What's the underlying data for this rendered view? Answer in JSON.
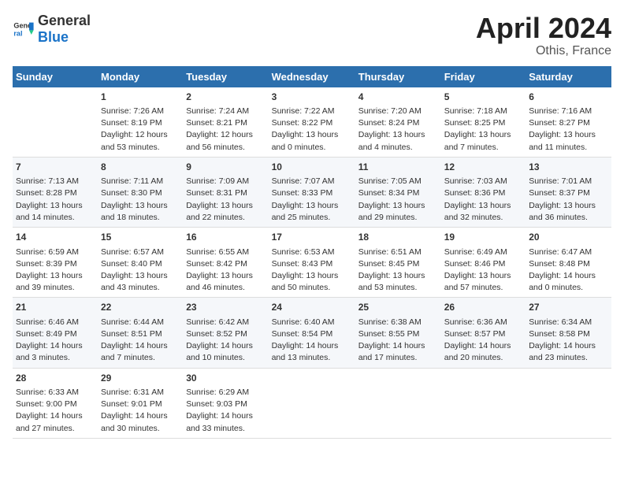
{
  "header": {
    "logo_general": "General",
    "logo_blue": "Blue",
    "title": "April 2024",
    "subtitle": "Othis, France"
  },
  "columns": [
    "Sunday",
    "Monday",
    "Tuesday",
    "Wednesday",
    "Thursday",
    "Friday",
    "Saturday"
  ],
  "weeks": [
    [
      {
        "num": "",
        "info": ""
      },
      {
        "num": "1",
        "info": "Sunrise: 7:26 AM\nSunset: 8:19 PM\nDaylight: 12 hours\nand 53 minutes."
      },
      {
        "num": "2",
        "info": "Sunrise: 7:24 AM\nSunset: 8:21 PM\nDaylight: 12 hours\nand 56 minutes."
      },
      {
        "num": "3",
        "info": "Sunrise: 7:22 AM\nSunset: 8:22 PM\nDaylight: 13 hours\nand 0 minutes."
      },
      {
        "num": "4",
        "info": "Sunrise: 7:20 AM\nSunset: 8:24 PM\nDaylight: 13 hours\nand 4 minutes."
      },
      {
        "num": "5",
        "info": "Sunrise: 7:18 AM\nSunset: 8:25 PM\nDaylight: 13 hours\nand 7 minutes."
      },
      {
        "num": "6",
        "info": "Sunrise: 7:16 AM\nSunset: 8:27 PM\nDaylight: 13 hours\nand 11 minutes."
      }
    ],
    [
      {
        "num": "7",
        "info": "Sunrise: 7:13 AM\nSunset: 8:28 PM\nDaylight: 13 hours\nand 14 minutes."
      },
      {
        "num": "8",
        "info": "Sunrise: 7:11 AM\nSunset: 8:30 PM\nDaylight: 13 hours\nand 18 minutes."
      },
      {
        "num": "9",
        "info": "Sunrise: 7:09 AM\nSunset: 8:31 PM\nDaylight: 13 hours\nand 22 minutes."
      },
      {
        "num": "10",
        "info": "Sunrise: 7:07 AM\nSunset: 8:33 PM\nDaylight: 13 hours\nand 25 minutes."
      },
      {
        "num": "11",
        "info": "Sunrise: 7:05 AM\nSunset: 8:34 PM\nDaylight: 13 hours\nand 29 minutes."
      },
      {
        "num": "12",
        "info": "Sunrise: 7:03 AM\nSunset: 8:36 PM\nDaylight: 13 hours\nand 32 minutes."
      },
      {
        "num": "13",
        "info": "Sunrise: 7:01 AM\nSunset: 8:37 PM\nDaylight: 13 hours\nand 36 minutes."
      }
    ],
    [
      {
        "num": "14",
        "info": "Sunrise: 6:59 AM\nSunset: 8:39 PM\nDaylight: 13 hours\nand 39 minutes."
      },
      {
        "num": "15",
        "info": "Sunrise: 6:57 AM\nSunset: 8:40 PM\nDaylight: 13 hours\nand 43 minutes."
      },
      {
        "num": "16",
        "info": "Sunrise: 6:55 AM\nSunset: 8:42 PM\nDaylight: 13 hours\nand 46 minutes."
      },
      {
        "num": "17",
        "info": "Sunrise: 6:53 AM\nSunset: 8:43 PM\nDaylight: 13 hours\nand 50 minutes."
      },
      {
        "num": "18",
        "info": "Sunrise: 6:51 AM\nSunset: 8:45 PM\nDaylight: 13 hours\nand 53 minutes."
      },
      {
        "num": "19",
        "info": "Sunrise: 6:49 AM\nSunset: 8:46 PM\nDaylight: 13 hours\nand 57 minutes."
      },
      {
        "num": "20",
        "info": "Sunrise: 6:47 AM\nSunset: 8:48 PM\nDaylight: 14 hours\nand 0 minutes."
      }
    ],
    [
      {
        "num": "21",
        "info": "Sunrise: 6:46 AM\nSunset: 8:49 PM\nDaylight: 14 hours\nand 3 minutes."
      },
      {
        "num": "22",
        "info": "Sunrise: 6:44 AM\nSunset: 8:51 PM\nDaylight: 14 hours\nand 7 minutes."
      },
      {
        "num": "23",
        "info": "Sunrise: 6:42 AM\nSunset: 8:52 PM\nDaylight: 14 hours\nand 10 minutes."
      },
      {
        "num": "24",
        "info": "Sunrise: 6:40 AM\nSunset: 8:54 PM\nDaylight: 14 hours\nand 13 minutes."
      },
      {
        "num": "25",
        "info": "Sunrise: 6:38 AM\nSunset: 8:55 PM\nDaylight: 14 hours\nand 17 minutes."
      },
      {
        "num": "26",
        "info": "Sunrise: 6:36 AM\nSunset: 8:57 PM\nDaylight: 14 hours\nand 20 minutes."
      },
      {
        "num": "27",
        "info": "Sunrise: 6:34 AM\nSunset: 8:58 PM\nDaylight: 14 hours\nand 23 minutes."
      }
    ],
    [
      {
        "num": "28",
        "info": "Sunrise: 6:33 AM\nSunset: 9:00 PM\nDaylight: 14 hours\nand 27 minutes."
      },
      {
        "num": "29",
        "info": "Sunrise: 6:31 AM\nSunset: 9:01 PM\nDaylight: 14 hours\nand 30 minutes."
      },
      {
        "num": "30",
        "info": "Sunrise: 6:29 AM\nSunset: 9:03 PM\nDaylight: 14 hours\nand 33 minutes."
      },
      {
        "num": "",
        "info": ""
      },
      {
        "num": "",
        "info": ""
      },
      {
        "num": "",
        "info": ""
      },
      {
        "num": "",
        "info": ""
      }
    ]
  ]
}
